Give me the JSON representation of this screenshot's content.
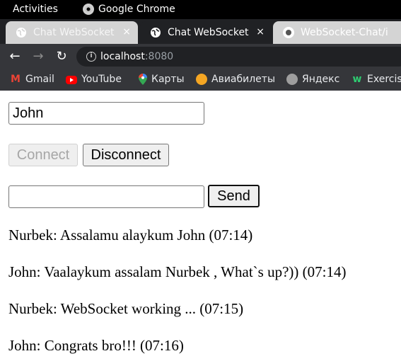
{
  "topbar": {
    "activities": "Activities",
    "app_name": "Google Chrome"
  },
  "tabs": [
    {
      "title": "Chat WebSocket",
      "close": "×"
    },
    {
      "title": "Chat WebSocket",
      "close": "×"
    },
    {
      "title": "WebSocket-Chat/i",
      "close": ""
    }
  ],
  "toolbar": {
    "back": "←",
    "forward": "→",
    "reload": "↻",
    "host": "localhost",
    "port": ":8080"
  },
  "bookmarks": [
    {
      "label": "Gmail"
    },
    {
      "label": "YouTube"
    },
    {
      "label": "Карты"
    },
    {
      "label": "Авиабилеты"
    },
    {
      "label": "Яндекс"
    },
    {
      "label": "Exercis"
    }
  ],
  "form": {
    "name_value": "John",
    "connect_label": "Connect",
    "disconnect_label": "Disconnect",
    "message_value": "",
    "send_label": "Send"
  },
  "messages": [
    "Nurbek: Assalamu alaykum John (07:14)",
    "John: Vaalaykum assalam Nurbek , What`s up?)) (07:14)",
    "Nurbek: WebSocket working ... (07:15)",
    "John: Congrats bro!!! (07:16)"
  ]
}
